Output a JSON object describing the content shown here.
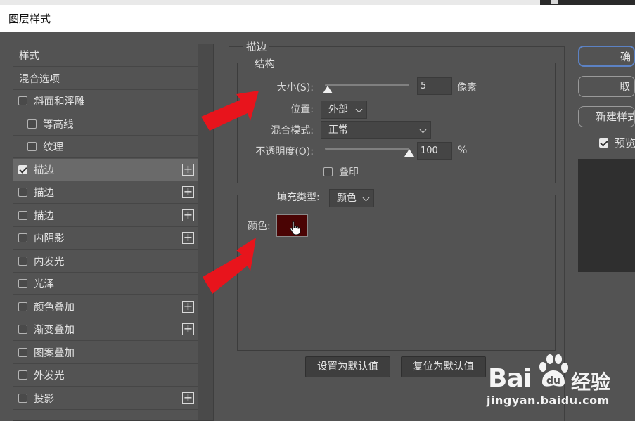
{
  "window": {
    "title": "图层样式"
  },
  "styles_list": {
    "items": [
      {
        "label": "样式",
        "checkbox": false,
        "checked": false,
        "indent": false,
        "plus": false,
        "selected": false
      },
      {
        "label": "混合选项",
        "checkbox": false,
        "checked": false,
        "indent": false,
        "plus": false,
        "selected": false
      },
      {
        "label": "斜面和浮雕",
        "checkbox": true,
        "checked": false,
        "indent": false,
        "plus": false,
        "selected": false
      },
      {
        "label": "等高线",
        "checkbox": true,
        "checked": false,
        "indent": true,
        "plus": false,
        "selected": false
      },
      {
        "label": "纹理",
        "checkbox": true,
        "checked": false,
        "indent": true,
        "plus": false,
        "selected": false
      },
      {
        "label": "描边",
        "checkbox": true,
        "checked": true,
        "indent": false,
        "plus": true,
        "selected": true
      },
      {
        "label": "描边",
        "checkbox": true,
        "checked": false,
        "indent": false,
        "plus": true,
        "selected": false
      },
      {
        "label": "描边",
        "checkbox": true,
        "checked": false,
        "indent": false,
        "plus": true,
        "selected": false
      },
      {
        "label": "内阴影",
        "checkbox": true,
        "checked": false,
        "indent": false,
        "plus": true,
        "selected": false
      },
      {
        "label": "内发光",
        "checkbox": true,
        "checked": false,
        "indent": false,
        "plus": false,
        "selected": false
      },
      {
        "label": "光泽",
        "checkbox": true,
        "checked": false,
        "indent": false,
        "plus": false,
        "selected": false
      },
      {
        "label": "颜色叠加",
        "checkbox": true,
        "checked": false,
        "indent": false,
        "plus": true,
        "selected": false
      },
      {
        "label": "渐变叠加",
        "checkbox": true,
        "checked": false,
        "indent": false,
        "plus": true,
        "selected": false
      },
      {
        "label": "图案叠加",
        "checkbox": true,
        "checked": false,
        "indent": false,
        "plus": false,
        "selected": false
      },
      {
        "label": "外发光",
        "checkbox": true,
        "checked": false,
        "indent": false,
        "plus": false,
        "selected": false
      },
      {
        "label": "投影",
        "checkbox": true,
        "checked": false,
        "indent": false,
        "plus": true,
        "selected": false
      }
    ],
    "plus_symbol": "+"
  },
  "stroke": {
    "section_title": "描边",
    "structure": {
      "title": "结构",
      "size_label": "大小(S):",
      "size_value": "5",
      "size_fraction": 0.02,
      "size_unit": "像素",
      "position_label": "位置:",
      "position_value": "外部",
      "blend_mode_label": "混合模式:",
      "blend_mode_value": "正常",
      "opacity_label": "不透明度(O):",
      "opacity_value": "100",
      "opacity_fraction": 1.0,
      "opacity_unit": "%",
      "overprint_label": "叠印",
      "overprint_checked": false
    },
    "fill": {
      "fill_type_label": "填充类型:",
      "fill_type_value": "颜色",
      "color_label": "颜色:",
      "color_value": "#4a0404"
    },
    "make_default_label": "设置为默认值",
    "reset_default_label": "复位为默认值"
  },
  "right_panel": {
    "ok_label": "确",
    "cancel_label": "取",
    "new_style_label": "新建样式",
    "preview_label": "预览",
    "preview_checked": true
  },
  "watermark": {
    "brand_left": "Bai",
    "brand_right": "经验",
    "url": "jingyan.baidu.com"
  },
  "colors": {
    "accent_arrow": "#e8141c",
    "primary_border": "#5c82c4",
    "dialog_bg": "#535353"
  },
  "cursor_icon": "hand-pointer-icon"
}
